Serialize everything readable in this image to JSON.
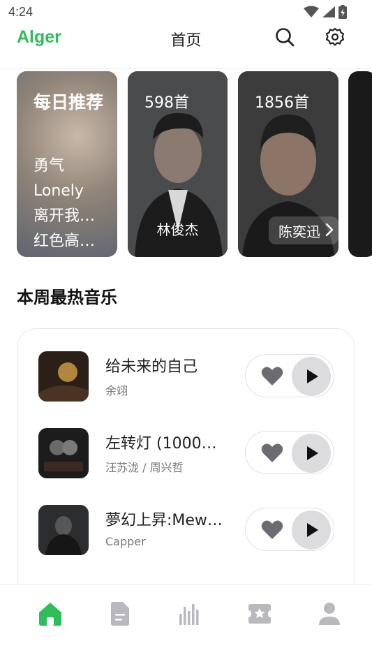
{
  "status_bar": {
    "time": "4:24"
  },
  "header": {
    "brand": "Alger",
    "title": "首页",
    "icons": [
      "search-icon",
      "gear-icon"
    ]
  },
  "carousel": {
    "daily": {
      "title": "每日推荐",
      "songs": [
        "勇气",
        "Lonely",
        "离开我…",
        "红色高…"
      ]
    },
    "playlists": [
      {
        "count": "598首",
        "artist": "林俊杰"
      },
      {
        "count": "1856首",
        "artist": "陈奕迅"
      }
    ]
  },
  "section": {
    "title": "本周最热音乐"
  },
  "songs": [
    {
      "title": "给未来的自己",
      "artist": "余翊"
    },
    {
      "title": "左转灯 (1000…",
      "artist": "汪苏泷 / 周兴哲"
    },
    {
      "title": "夢幻上昇:Mew…",
      "artist": "Capper"
    }
  ],
  "bottom_nav": {
    "items": [
      "home-icon",
      "document-icon",
      "chart-bars-icon",
      "ticket-icon",
      "user-icon"
    ],
    "active": "home-icon"
  },
  "colors": {
    "accent": "#2fbd5a",
    "nav_inactive": "#b9b9bd",
    "heart": "#6b6b72"
  }
}
